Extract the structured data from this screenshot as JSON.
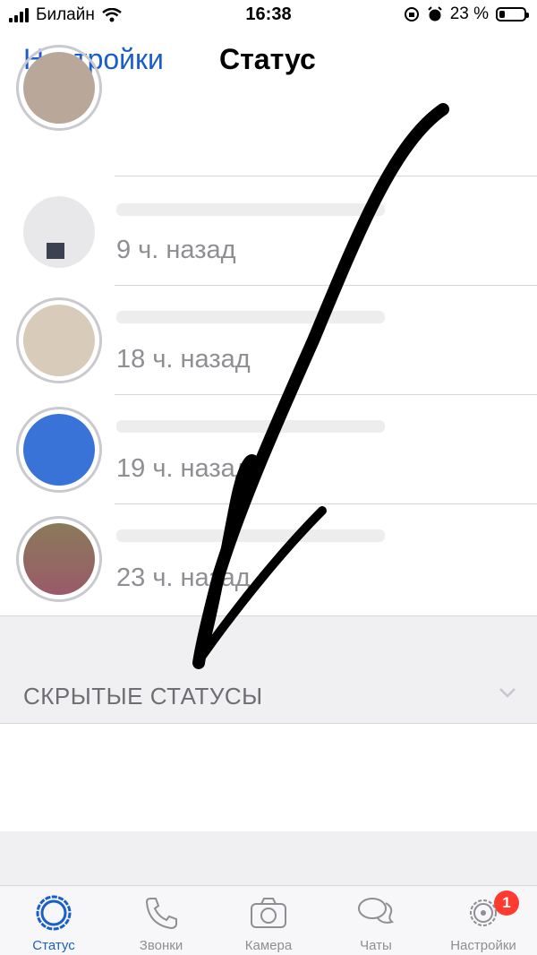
{
  "status_bar": {
    "carrier": "Билайн",
    "time": "16:38",
    "battery_percent": "23 %",
    "battery_level": 0.23
  },
  "nav": {
    "back_label": "Настройки",
    "title": "Статус"
  },
  "statuses": [
    {
      "time": ""
    },
    {
      "time": "9 ч. назад"
    },
    {
      "time": "18 ч. назад"
    },
    {
      "time": "19 ч. назад"
    },
    {
      "time": "23 ч. назад"
    }
  ],
  "hidden_section": {
    "title": "СКРЫТЫЕ СТАТУСЫ"
  },
  "tabs": [
    {
      "label": "Статус",
      "icon": "status-icon",
      "active": true
    },
    {
      "label": "Звонки",
      "icon": "phone-icon"
    },
    {
      "label": "Камера",
      "icon": "camera-icon"
    },
    {
      "label": "Чаты",
      "icon": "chats-icon"
    },
    {
      "label": "Настройки",
      "icon": "gear-icon",
      "badge": "1"
    }
  ],
  "colors": {
    "accent": "#1a5fc9",
    "badge": "#ff3b30"
  }
}
